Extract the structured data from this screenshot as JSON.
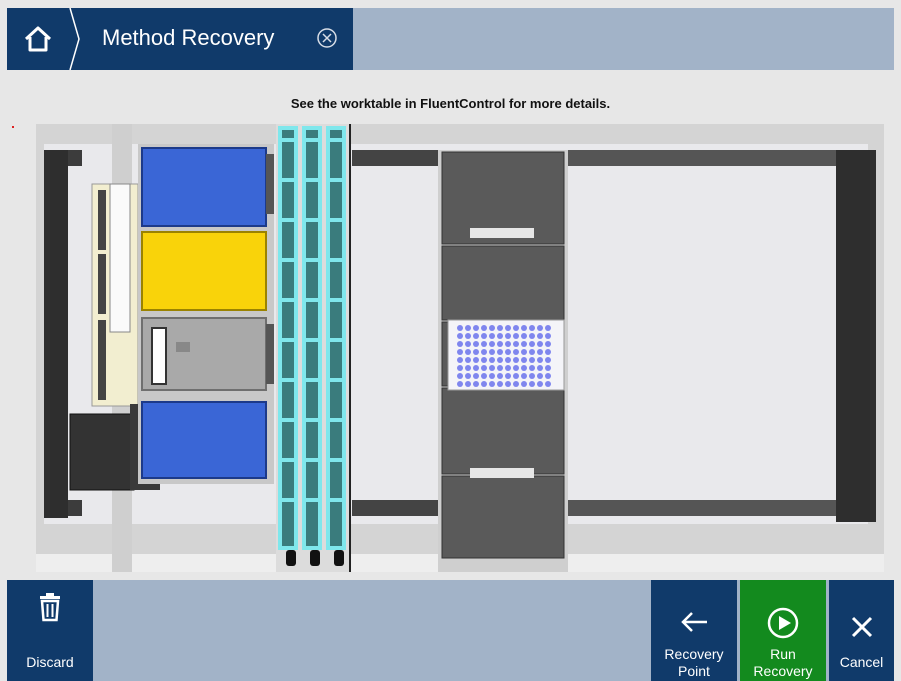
{
  "header": {
    "title": "Method Recovery"
  },
  "notice": "See the worktable in FluentControl for more details.",
  "footer": {
    "discard_label": "Discard",
    "recovery_point_label": "Recovery\nPoint",
    "run_recovery_label": "Run\nRecovery",
    "cancel_label": "Cancel"
  },
  "icons": {
    "home": "home-icon",
    "close": "close-circle-icon",
    "discard": "trash-icon",
    "recovery_point": "arrow-left-icon",
    "run_recovery": "play-circle-icon",
    "cancel": "x-icon"
  },
  "colors": {
    "header_blue": "#103a6a",
    "bar_background": "#a2b3c8",
    "run_green": "#138a1e",
    "trough_blue": "#3a66d6",
    "trough_yellow": "#f9d30a",
    "plate_wells": "#7f86ee",
    "tip_cyan": "#7fe7ec"
  }
}
